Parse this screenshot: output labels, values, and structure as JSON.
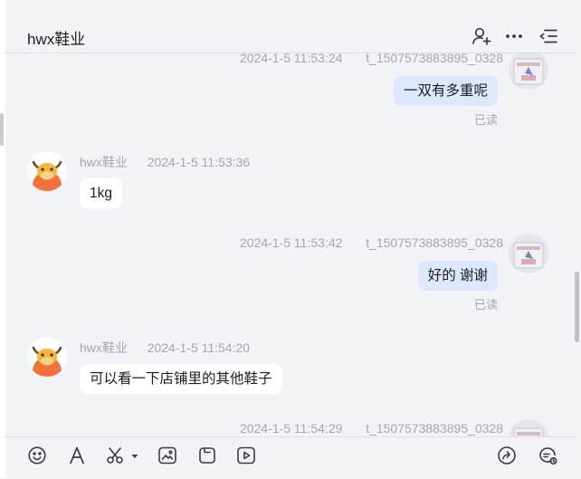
{
  "header": {
    "title": "hwx鞋业",
    "icons": [
      "add-contact-icon",
      "more-icon",
      "menu-list-icon"
    ]
  },
  "messages": [
    {
      "direction": "outgoing",
      "timestamp": "2024-1-5 11:53:24",
      "sender": "t_1507573883895_0328",
      "text": "一双有多重呢",
      "status": "已读"
    },
    {
      "direction": "incoming",
      "timestamp": "2024-1-5 11:53:36",
      "sender": "hwx鞋业",
      "text": "1kg"
    },
    {
      "direction": "outgoing",
      "timestamp": "2024-1-5 11:53:42",
      "sender": "t_1507573883895_0328",
      "text": "好的 谢谢",
      "status": "已读"
    },
    {
      "direction": "incoming",
      "timestamp": "2024-1-5 11:54:20",
      "sender": "hwx鞋业",
      "text": "可以看一下店铺里的其他鞋子"
    },
    {
      "direction": "outgoing",
      "timestamp": "2024-1-5 11:54:29",
      "sender": "t_1507573883895_0328"
    }
  ],
  "toolbar": {
    "icons": [
      "emoji-icon",
      "font-icon",
      "scissors-icon",
      "image-icon",
      "file-icon",
      "video-icon",
      "share-icon",
      "chat-history-icon"
    ]
  },
  "colors": {
    "background": "#f2f3f7",
    "outgoing_bubble": "#dde8ff",
    "incoming_bubble": "#ffffff",
    "meta_text": "#a4a7ad"
  }
}
